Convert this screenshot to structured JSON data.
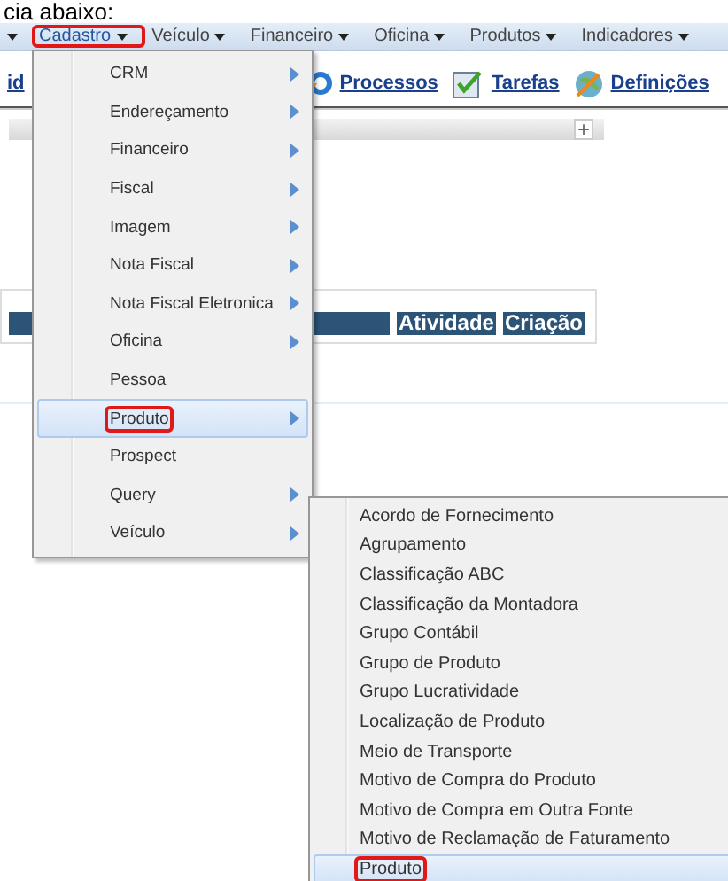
{
  "caption": "cia abaixo:",
  "menubar": [
    {
      "label": "Cadastro",
      "annotated": true
    },
    {
      "label": "Veículo",
      "annotated": false
    },
    {
      "label": "Financeiro",
      "annotated": false
    },
    {
      "label": "Oficina",
      "annotated": false
    },
    {
      "label": "Produtos",
      "annotated": false
    },
    {
      "label": "Indicadores",
      "annotated": false
    }
  ],
  "toolbar": {
    "cut_text": "id",
    "links": [
      "Processos",
      "Tarefas",
      "Definições"
    ]
  },
  "panel": {
    "button": "+"
  },
  "table": {
    "columns": [
      "Atividade",
      "Criação"
    ]
  },
  "menu": [
    {
      "label": "CRM",
      "submenu": true,
      "selected": false,
      "annotated": false
    },
    {
      "label": "Endereçamento",
      "submenu": true,
      "selected": false,
      "annotated": false
    },
    {
      "label": "Financeiro",
      "submenu": true,
      "selected": false,
      "annotated": false
    },
    {
      "label": "Fiscal",
      "submenu": true,
      "selected": false,
      "annotated": false
    },
    {
      "label": "Imagem",
      "submenu": true,
      "selected": false,
      "annotated": false
    },
    {
      "label": "Nota Fiscal",
      "submenu": true,
      "selected": false,
      "annotated": false
    },
    {
      "label": "Nota Fiscal Eletronica",
      "submenu": true,
      "selected": false,
      "annotated": false
    },
    {
      "label": "Oficina",
      "submenu": true,
      "selected": false,
      "annotated": false
    },
    {
      "label": "Pessoa",
      "submenu": false,
      "selected": false,
      "annotated": false
    },
    {
      "label": "Produto",
      "submenu": true,
      "selected": true,
      "annotated": true
    },
    {
      "label": "Prospect",
      "submenu": false,
      "selected": false,
      "annotated": false
    },
    {
      "label": "Query",
      "submenu": true,
      "selected": false,
      "annotated": false
    },
    {
      "label": "Veículo",
      "submenu": true,
      "selected": false,
      "annotated": false
    }
  ],
  "submenu": [
    {
      "label": "Acordo de Fornecimento",
      "selected": false,
      "annotated": false
    },
    {
      "label": "Agrupamento",
      "selected": false,
      "annotated": false
    },
    {
      "label": "Classificação ABC",
      "selected": false,
      "annotated": false
    },
    {
      "label": "Classificação da Montadora",
      "selected": false,
      "annotated": false
    },
    {
      "label": "Grupo Contábil",
      "selected": false,
      "annotated": false
    },
    {
      "label": "Grupo de Produto",
      "selected": false,
      "annotated": false
    },
    {
      "label": "Grupo Lucratividade",
      "selected": false,
      "annotated": false
    },
    {
      "label": "Localização de Produto",
      "selected": false,
      "annotated": false
    },
    {
      "label": "Meio de Transporte",
      "selected": false,
      "annotated": false
    },
    {
      "label": "Motivo de Compra do Produto",
      "selected": false,
      "annotated": false
    },
    {
      "label": "Motivo de Compra em Outra Fonte",
      "selected": false,
      "annotated": false
    },
    {
      "label": "Motivo de Reclamação de Faturamento",
      "selected": false,
      "annotated": false
    },
    {
      "label": "Produto",
      "selected": true,
      "annotated": true
    }
  ]
}
